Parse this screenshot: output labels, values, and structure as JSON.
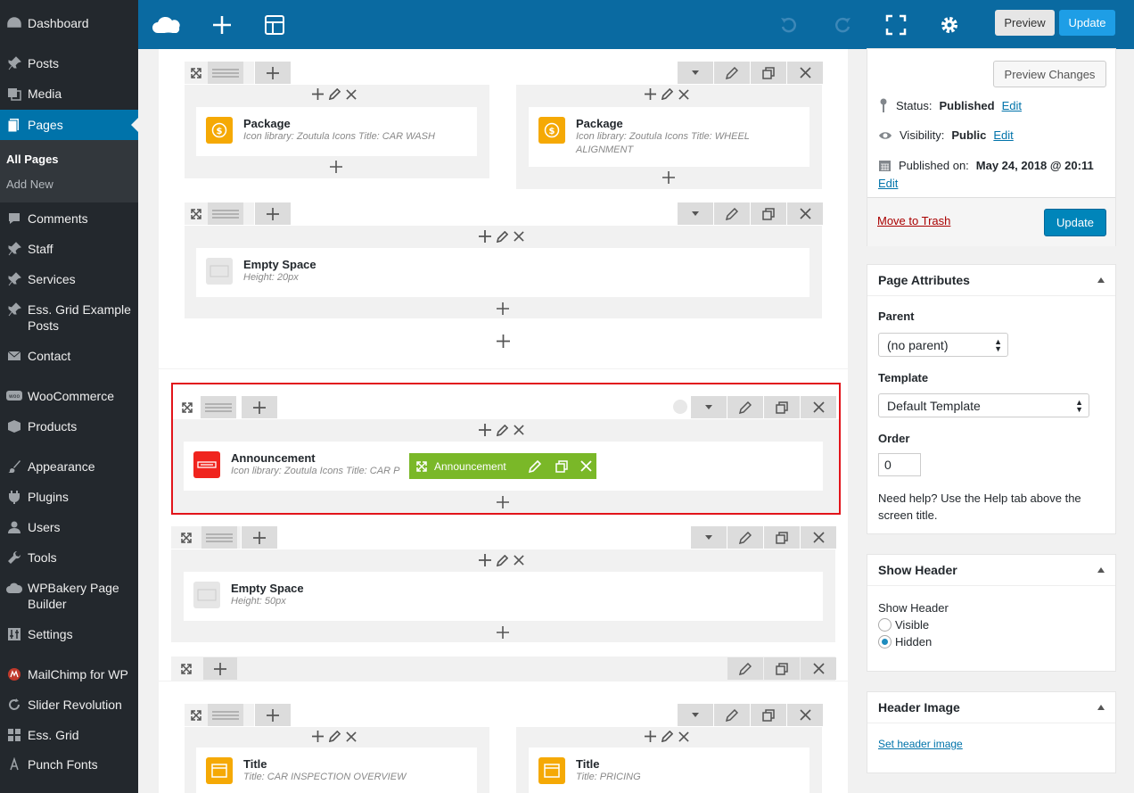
{
  "menu": {
    "items": [
      {
        "label": "Dashboard",
        "icon": "dashboard-icon"
      },
      {
        "label": "Posts",
        "icon": "pin-icon"
      },
      {
        "label": "Media",
        "icon": "media-icon"
      },
      {
        "label": "Pages",
        "icon": "pages-icon"
      },
      {
        "label": "Comments",
        "icon": "comment-icon"
      },
      {
        "label": "Staff",
        "icon": "pin-icon"
      },
      {
        "label": "Services",
        "icon": "pin-icon"
      },
      {
        "label": "Ess. Grid Example Posts",
        "icon": "pin-icon"
      },
      {
        "label": "Contact",
        "icon": "mail-icon"
      },
      {
        "label": "WooCommerce",
        "icon": "woo-icon"
      },
      {
        "label": "Products",
        "icon": "box-icon"
      },
      {
        "label": "Appearance",
        "icon": "brush-icon"
      },
      {
        "label": "Plugins",
        "icon": "plug-icon"
      },
      {
        "label": "Users",
        "icon": "user-icon"
      },
      {
        "label": "Tools",
        "icon": "wrench-icon"
      },
      {
        "label": "WPBakery Page Builder",
        "icon": "cloud-icon"
      },
      {
        "label": "Settings",
        "icon": "settings-icon"
      },
      {
        "label": "MailChimp for WP",
        "icon": "mailchimp-icon"
      },
      {
        "label": "Slider Revolution",
        "icon": "refresh-icon"
      },
      {
        "label": "Ess. Grid",
        "icon": "grid-icon"
      },
      {
        "label": "Punch Fonts",
        "icon": "font-icon"
      }
    ],
    "submenu": [
      "All Pages",
      "Add New"
    ]
  },
  "toolbar": {
    "preview": "Preview",
    "update": "Update"
  },
  "builder": {
    "package1": {
      "title": "Package",
      "desc": "Icon library: Zoutula Icons  Title: CAR WASH"
    },
    "package2": {
      "title": "Package",
      "desc": "Icon library: Zoutula Icons  Title: WHEEL ALIGNMENT"
    },
    "empty1": {
      "title": "Empty Space",
      "desc": "Height: 20px"
    },
    "announcement": {
      "title": "Announcement",
      "desc": "Icon library: Zoutula Icons  Title: CAR P"
    },
    "hover_label": "Announcement",
    "empty2": {
      "title": "Empty Space",
      "desc": "Height: 50px"
    },
    "title1": {
      "title": "Title",
      "desc": "Title: CAR INSPECTION OVERVIEW"
    },
    "title2": {
      "title": "Title",
      "desc": "Title: PRICING"
    },
    "colors": {
      "package": "#f5a905",
      "announcement": "#f0241e",
      "hover": "#7ab828",
      "highlight": "#e2141a"
    }
  },
  "publish": {
    "preview_changes": "Preview Changes",
    "status_label": "Status:",
    "status_value": "Published",
    "edit": "Edit",
    "visibility_label": "Visibility:",
    "visibility_value": "Public",
    "published_label": "Published on:",
    "published_value": "May 24, 2018 @ 20:11",
    "trash": "Move to Trash",
    "update": "Update"
  },
  "attributes": {
    "title": "Page Attributes",
    "parent_label": "Parent",
    "parent_value": "(no parent)",
    "template_label": "Template",
    "template_value": "Default Template",
    "order_label": "Order",
    "order_value": "0",
    "help": "Need help? Use the Help tab above the screen title."
  },
  "show_header": {
    "title": "Show Header",
    "label": "Show Header",
    "options": [
      "Visible",
      "Hidden"
    ],
    "selected": "Hidden"
  },
  "header_image": {
    "title": "Header Image",
    "link": "Set header image"
  }
}
